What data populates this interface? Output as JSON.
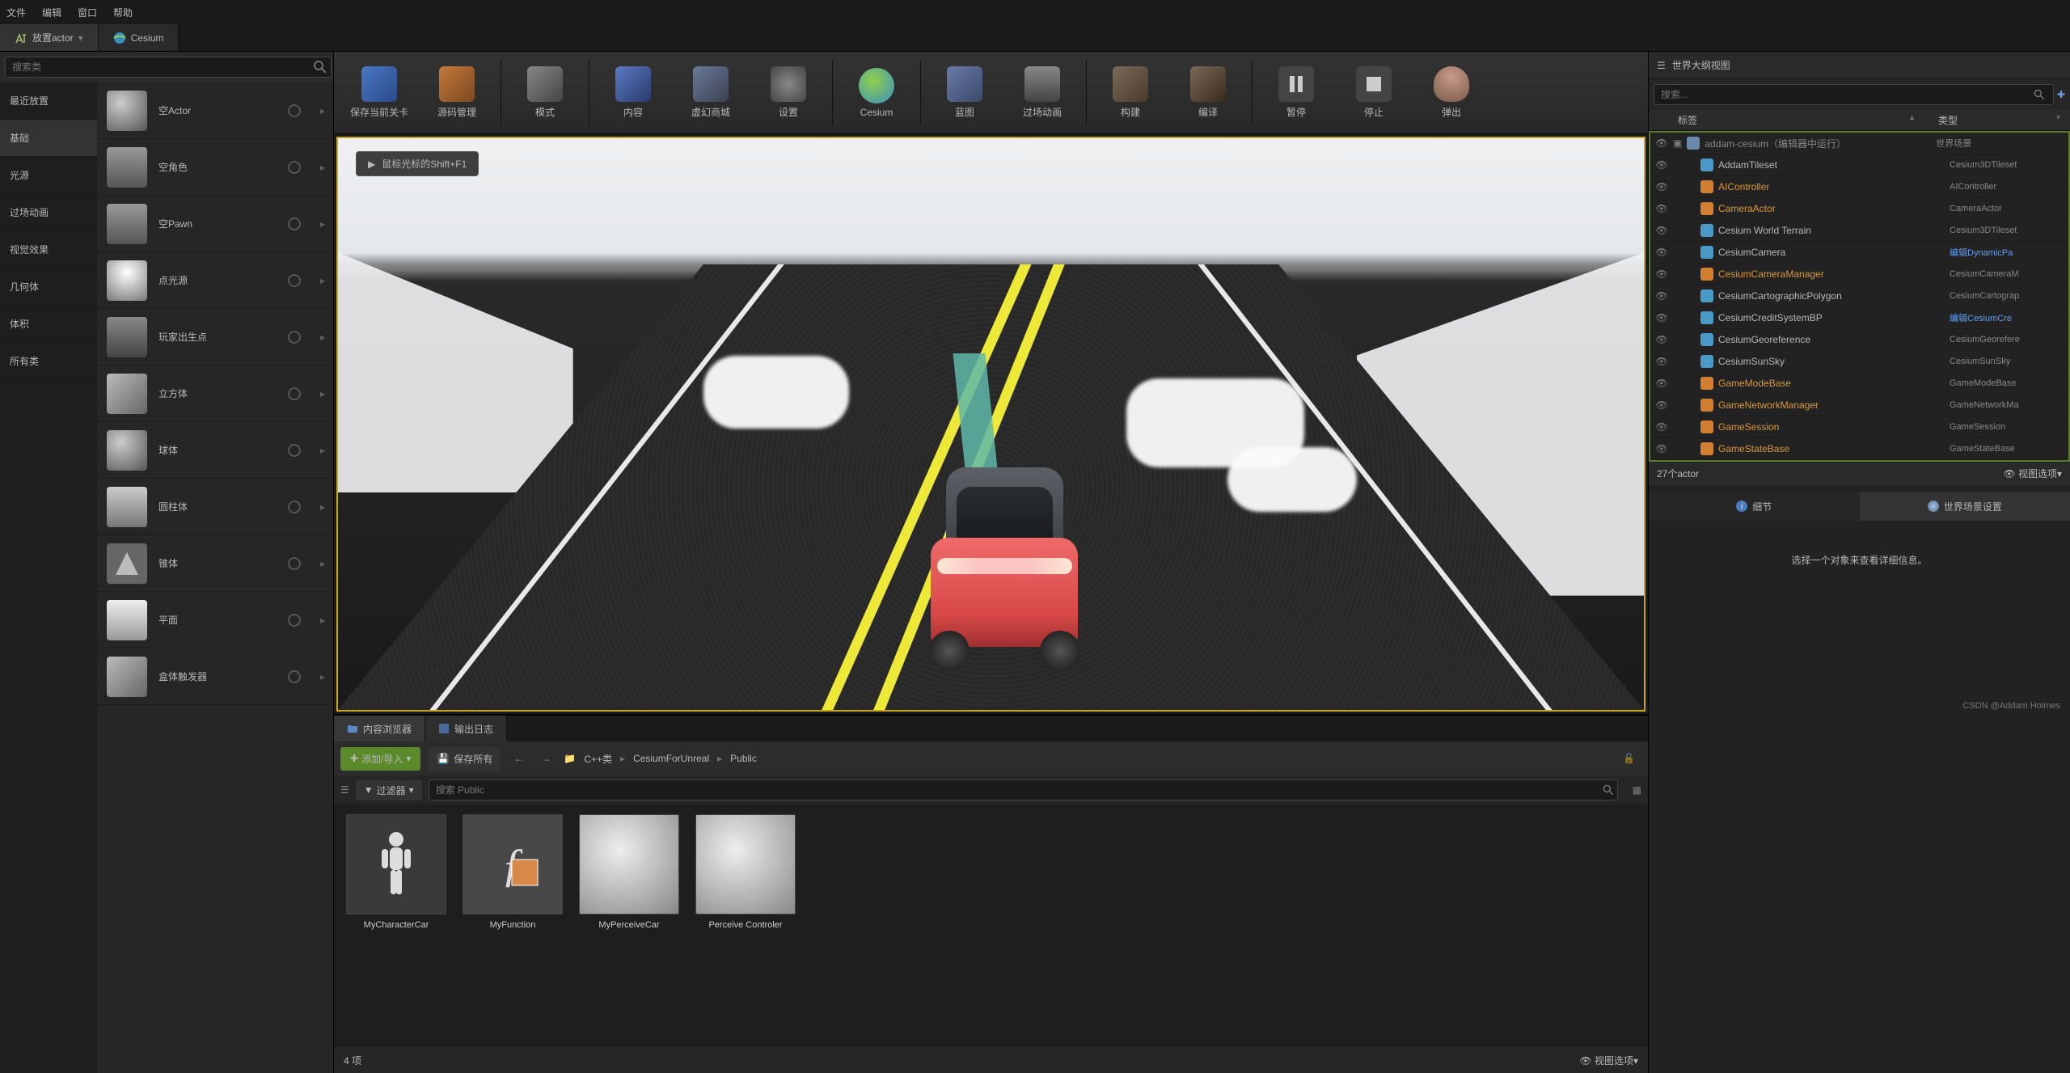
{
  "menu": {
    "file": "文件",
    "edit": "编辑",
    "window": "窗口",
    "help": "帮助"
  },
  "tabs": {
    "place": "放置actor",
    "cesium": "Cesium"
  },
  "left": {
    "search_ph": "搜索类",
    "cats": [
      "最近放置",
      "基础",
      "光源",
      "过场动画",
      "视觉效果",
      "几何体",
      "体积",
      "所有类"
    ],
    "actors": [
      "空Actor",
      "空角色",
      "空Pawn",
      "点光源",
      "玩家出生点",
      "立方体",
      "球体",
      "圆柱体",
      "锥体",
      "平面",
      "盒体触发器"
    ]
  },
  "toolbar": {
    "items": [
      "保存当前关卡",
      "源码管理",
      "模式",
      "内容",
      "虚幻商城",
      "设置",
      "Cesium",
      "蓝图",
      "过场动画",
      "构建",
      "编译",
      "暂停",
      "停止",
      "弹出"
    ]
  },
  "viewport": {
    "hint": "鼠标光标的Shift+F1"
  },
  "outliner": {
    "title": "世界大纲视图",
    "search_ph": "搜索...",
    "col1": "标签",
    "col2": "类型",
    "root": {
      "name": "addam-cesium（编辑器中运行）",
      "type": "世界场景"
    },
    "rows": [
      {
        "n": "AddamTileset",
        "t": "Cesium3DTileset",
        "c": ""
      },
      {
        "n": "AIController",
        "t": "AIController",
        "c": "orange"
      },
      {
        "n": "CameraActor",
        "t": "CameraActor",
        "c": "orange"
      },
      {
        "n": "Cesium World Terrain",
        "t": "Cesium3DTileset",
        "c": ""
      },
      {
        "n": "CesiumCamera",
        "t": "编辑DynamicPa",
        "c": "",
        "tl": "bluelink"
      },
      {
        "n": "CesiumCameraManager",
        "t": "CesiumCameraM",
        "c": "orange"
      },
      {
        "n": "CesiumCartographicPolygon",
        "t": "CesiumCartograp",
        "c": ""
      },
      {
        "n": "CesiumCreditSystemBP",
        "t": "编辑CesiumCre",
        "c": "",
        "tl": "bluelink"
      },
      {
        "n": "CesiumGeoreference",
        "t": "CesiumGeorefere",
        "c": ""
      },
      {
        "n": "CesiumSunSky",
        "t": "CesiumSunSky",
        "c": ""
      },
      {
        "n": "GameModeBase",
        "t": "GameModeBase",
        "c": "orange"
      },
      {
        "n": "GameNetworkManager",
        "t": "GameNetworkMa",
        "c": "orange"
      },
      {
        "n": "GameSession",
        "t": "GameSession",
        "c": "orange"
      },
      {
        "n": "GameStateBase",
        "t": "GameStateBase",
        "c": "orange"
      }
    ],
    "footer_count": "27个actor",
    "footer_view": "视图选项"
  },
  "details": {
    "tab1": "细节",
    "tab2": "世界场景设置",
    "empty": "选择一个对象来查看详细信息。"
  },
  "cb": {
    "tab1": "内容浏览器",
    "tab2": "输出日志",
    "add": "添加/导入",
    "save": "保存所有",
    "crumbs": [
      "C++类",
      "CesiumForUnreal",
      "Public"
    ],
    "filter": "过滤器",
    "search_ph": "搜索 Public",
    "assets": [
      "MyCharacterCar",
      "MyFunction",
      "MyPerceiveCar",
      "Perceive Controler"
    ],
    "footer_count": "4 项",
    "footer_view": "视图选项"
  },
  "watermark": "CSDN @Addam Holmes"
}
